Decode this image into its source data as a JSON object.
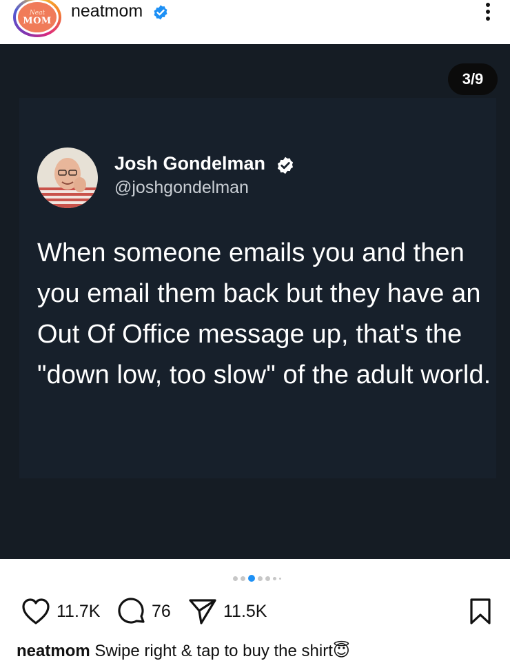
{
  "header": {
    "avatar_script": "Neat",
    "avatar_brand": "MOM",
    "username": "neatmom"
  },
  "post": {
    "counter": "3/9",
    "tweet": {
      "author_name": "Josh Gondelman",
      "author_handle": "@joshgondelman",
      "text": "When someone emails you and then you email them back but they have an Out Of Office message up, that's the \"down low, too slow\" of the adult world."
    }
  },
  "actions": {
    "likes": "11.7K",
    "comments": "76",
    "shares": "11.5K"
  },
  "caption": {
    "username": "neatmom",
    "text": "Swipe right & tap to buy the shirt",
    "emoji": "😇"
  },
  "colors": {
    "verified_blue": "#1d90f5",
    "post_bg": "#151c24",
    "tweet_bg": "#17202b"
  }
}
